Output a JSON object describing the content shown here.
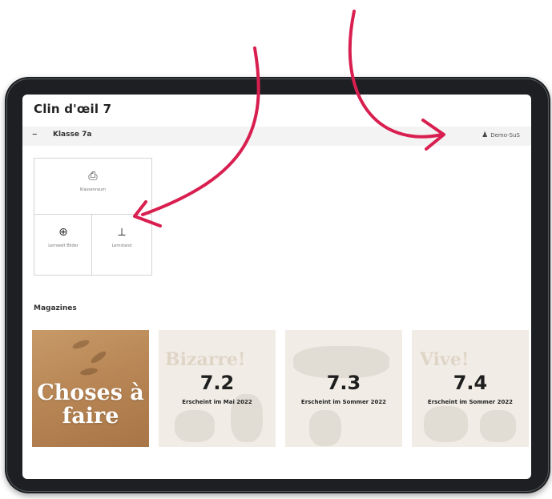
{
  "app": {
    "title": "Clin d'œil 7",
    "class_name": "Klasse 7a",
    "collapse_symbol": "–",
    "user_name": "Demo-SuS",
    "user_icon": "person-icon"
  },
  "tiles": [
    {
      "icon": "classroom-icon",
      "glyph": "⎙",
      "label": "Klassenraum"
    },
    {
      "icon": "globe-icon",
      "glyph": "⊕",
      "label": "Lernwelt Bilder"
    },
    {
      "icon": "teacher-desk-icon",
      "glyph": "⟂",
      "label": "Lernstand"
    }
  ],
  "magazines": {
    "heading": "Magazines",
    "items": [
      {
        "cover_text": "Choses à faire"
      },
      {
        "number": "7.2",
        "release": "Erscheint im Mai 2022",
        "ghost_title": "Bizarre!"
      },
      {
        "number": "7.3",
        "release": "Erscheint im Sommer 2022",
        "ghost_title": ""
      },
      {
        "number": "7.4",
        "release": "Erscheint im Sommer 2022",
        "ghost_title": "Vive!"
      }
    ]
  },
  "colors": {
    "arrow": "#d81f4f",
    "cover_brown": "#b98756",
    "tablet_frame": "#1d1f22"
  }
}
